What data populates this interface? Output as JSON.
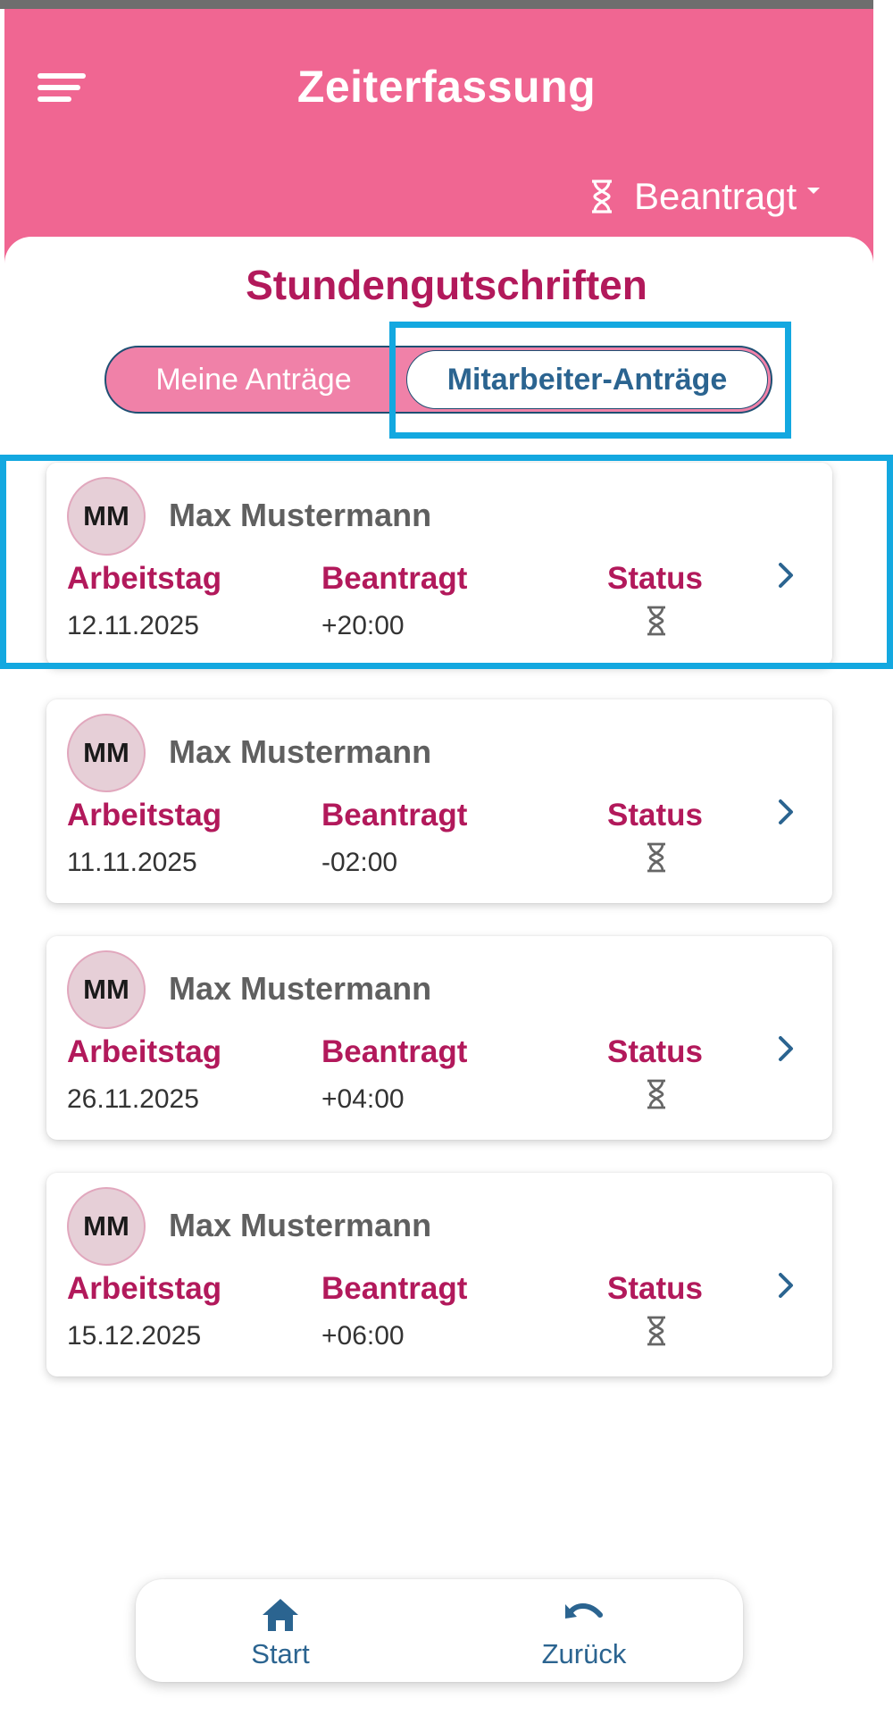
{
  "header": {
    "title": "Zeiterfassung",
    "filter_label": "Beantragt"
  },
  "section": {
    "title": "Stundengutschriften"
  },
  "tabs": [
    {
      "label": "Meine Anträge",
      "active": false
    },
    {
      "label": "Mitarbeiter-Anträge",
      "active": true
    }
  ],
  "labels": {
    "workday": "Arbeitstag",
    "requested": "Beantragt",
    "status": "Status"
  },
  "requests": [
    {
      "initials": "MM",
      "name": "Max Mustermann",
      "date": "12.11.2025",
      "amount": "+20:00",
      "status_icon": "hourglass-icon"
    },
    {
      "initials": "MM",
      "name": "Max Mustermann",
      "date": "11.11.2025",
      "amount": "-02:00",
      "status_icon": "hourglass-icon"
    },
    {
      "initials": "MM",
      "name": "Max Mustermann",
      "date": "26.11.2025",
      "amount": "+04:00",
      "status_icon": "hourglass-icon"
    },
    {
      "initials": "MM",
      "name": "Max Mustermann",
      "date": "15.12.2025",
      "amount": "+06:00",
      "status_icon": "hourglass-icon"
    }
  ],
  "bottom_nav": {
    "home_label": "Start",
    "back_label": "Zurück"
  },
  "colors": {
    "header": "#f06692",
    "accent": "#b2195b",
    "link": "#2b6490",
    "highlight": "#13a8e0"
  }
}
